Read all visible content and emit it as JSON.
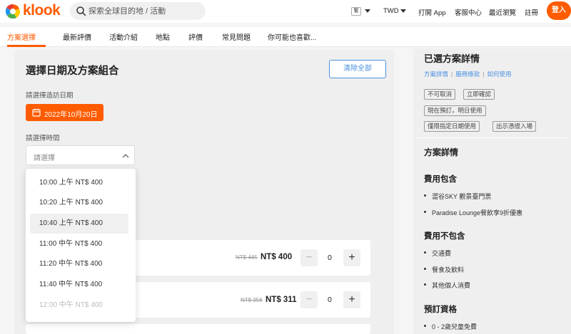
{
  "header": {
    "logo_text": "klook",
    "search_placeholder": "探索全球目的地 / 活動",
    "lang_chip": "繁",
    "currency": "TWD",
    "links": [
      "打開 App",
      "客服中心",
      "最近瀏覽",
      "註冊"
    ],
    "login_label": "登入"
  },
  "tabs": [
    "方案選擇",
    "最新評價",
    "活動介紹",
    "地點",
    "評價",
    "常見問題",
    "你可能也喜歡..."
  ],
  "booking": {
    "title": "選擇日期及方案組合",
    "clear_label": "清除全部",
    "date_label": "請選擇造訪日期",
    "date_value": "2022年10月20日",
    "time_label": "請選擇時間",
    "time_placeholder": "請選擇",
    "time_options": [
      "10:00 上午 NT$ 400",
      "10:20 上午 NT$ 400",
      "10:40 上午 NT$ 400",
      "11:00 中午 NT$ 400",
      "11:20 中午 NT$ 400",
      "11:40 中午 NT$ 400",
      "12:00 中午 NT$ 400"
    ],
    "rows": [
      {
        "old_price": "NT$ 445",
        "price": "NT$ 400",
        "qty": "0"
      },
      {
        "old_price": "NT$ 356",
        "price": "NT$ 311",
        "qty": "0"
      }
    ]
  },
  "summary": {
    "title": "已選方案詳情",
    "links": [
      "方案詳情",
      "服務條款",
      "如何使用"
    ],
    "tags": [
      "不可取消",
      "立即確認",
      "現在預訂，明日使用",
      "僅限指定日期使用",
      "出示憑證入場"
    ],
    "details_title": "方案詳情",
    "included_title": "費用包含",
    "included": [
      "澀谷SKY 觀景臺門票",
      "Paradise Lounge餐飲享9折優惠"
    ],
    "excluded_title": "費用不包含",
    "excluded": [
      "交通費",
      "餐食及飲料",
      "其他個人消費"
    ],
    "eligibility_title": "預訂資格",
    "eligibility": [
      "0 - 2歲兒童免費"
    ]
  },
  "colors": {
    "brand": "#ff5b00",
    "link": "#4a90e2"
  }
}
